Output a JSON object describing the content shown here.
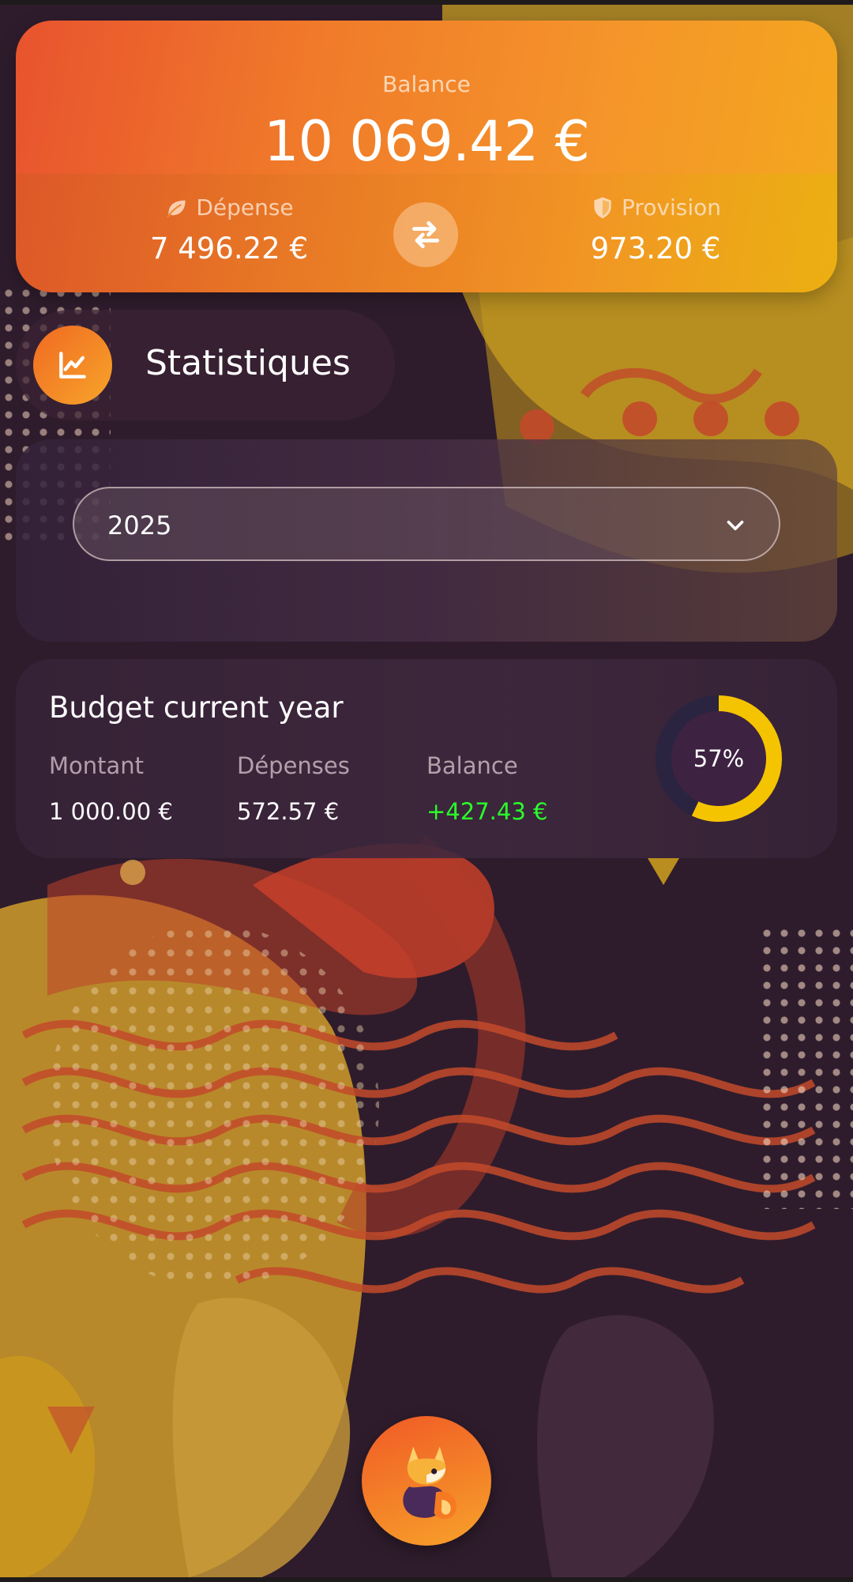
{
  "colors": {
    "accent_orange": "#f07a2a",
    "accent_yellow": "#f3a81e",
    "positive_green": "#2aff2a",
    "donut_fill": "#f5c400",
    "donut_track": "#2a2440"
  },
  "balance_card": {
    "label": "Balance",
    "value": "10 069.42 €",
    "expense": {
      "label": "Dépense",
      "value": "7 496.22 €",
      "icon": "leaf-icon"
    },
    "provision": {
      "label": "Provision",
      "value": "973.20 €",
      "icon": "shield-icon"
    },
    "swap_icon": "swap-arrows-icon"
  },
  "statistics": {
    "title": "Statistiques",
    "icon": "line-chart-icon"
  },
  "year_selector": {
    "selected": "2025",
    "icon": "chevron-down-icon"
  },
  "budget": {
    "title": "Budget current year",
    "amount_label": "Montant",
    "amount_value": "1 000.00 €",
    "expenses_label": "Dépenses",
    "expenses_value": "572.57 €",
    "balance_label": "Balance",
    "balance_value": "+427.43 €",
    "percent_text": "57%",
    "percent_value": 0.57
  },
  "bottom_button": {
    "icon": "fox-logo-icon"
  }
}
